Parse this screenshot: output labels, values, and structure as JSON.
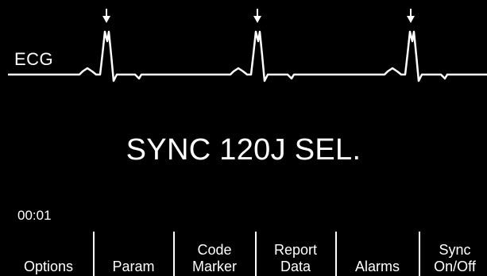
{
  "colors": {
    "background": "#000000",
    "foreground": "#ffffff"
  },
  "waveform": {
    "label": "ECG",
    "sync_markers": 3,
    "marker_icon": "down-arrow-icon"
  },
  "message": "SYNC 120J SEL.",
  "elapsed_time": "00:01",
  "softkeys": [
    {
      "lines": [
        "Options"
      ]
    },
    {
      "lines": [
        "Param"
      ]
    },
    {
      "lines": [
        "Code",
        "Marker"
      ]
    },
    {
      "lines": [
        "Report",
        "Data"
      ]
    },
    {
      "lines": [
        "Alarms"
      ]
    },
    {
      "lines": [
        "Sync",
        "On/Off"
      ]
    }
  ]
}
